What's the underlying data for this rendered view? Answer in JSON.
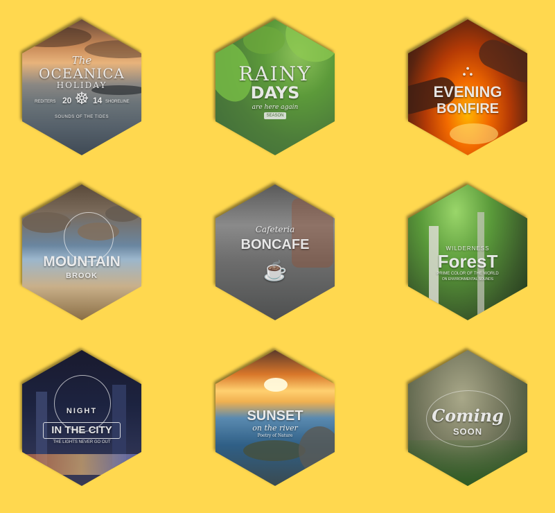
{
  "tiles": [
    {
      "id": "oceanica-holiday",
      "lines": {
        "script": "The",
        "title": "OCEANICA",
        "subtitle": "HOLIDAY",
        "left_tag": "REDITERS",
        "year_left": "20",
        "year_right": "14",
        "right_tag": "SHORELINE",
        "tagline": "SOUNDS OF THE TIDES"
      }
    },
    {
      "id": "rainy-days",
      "lines": {
        "title": "RAINY",
        "subtitle": "DAYS",
        "script": "are here again",
        "badge": "SEASON"
      }
    },
    {
      "id": "evening-bonfire",
      "lines": {
        "title": "EVENING",
        "subtitle": "BONFIRE"
      }
    },
    {
      "id": "mountain-brook",
      "lines": {
        "title": "MOUNTAIN",
        "subtitle": "BROOK"
      }
    },
    {
      "id": "cafeteria-boncafe",
      "lines": {
        "script": "Cafeteria",
        "title": "BONCAFE"
      }
    },
    {
      "id": "wilderness-forest",
      "lines": {
        "top": "WILDERNESS",
        "title": "ForesT",
        "tagline": "PRIME COLOR OF THE WORLD",
        "small": "ON ENVIRONMENTAL SOUNDS"
      }
    },
    {
      "id": "night-in-the-city",
      "lines": {
        "top": "NIGHT",
        "title": "IN THE CITY",
        "tagline": "THE LIGHTS NEVER GO OUT"
      }
    },
    {
      "id": "sunset-on-the-river",
      "lines": {
        "title": "SUNSET",
        "script": "on the river",
        "tagline": "Poetry of Nature"
      }
    },
    {
      "id": "coming-soon",
      "lines": {
        "script": "Coming",
        "title": "SOON"
      }
    }
  ]
}
